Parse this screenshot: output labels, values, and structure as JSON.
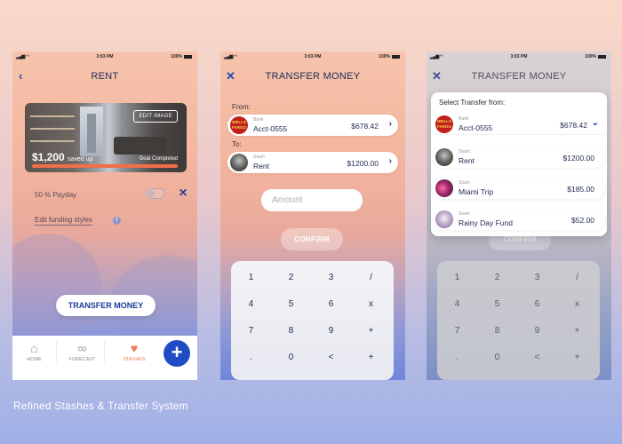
{
  "status": {
    "time": "3:03 PM",
    "battery": "100%"
  },
  "screen1": {
    "title": "RENT",
    "edit_image": "EDIT IMAGE",
    "saved_amount": "$1,200",
    "saved_label": "saved up",
    "goal": "Goal Completed",
    "payday": "50 % Payday",
    "funding_link": "Edit funding styles",
    "transfer_button": "TRANSFER MONEY",
    "tabs": [
      {
        "label": "HOME",
        "icon": "home-icon"
      },
      {
        "label": "FORECAST",
        "icon": "binoculars-icon"
      },
      {
        "label": "STASHES",
        "icon": "piggy-bank-icon"
      }
    ],
    "accent": "#ef7a5c",
    "primary": "#1f4bc4"
  },
  "screen2": {
    "title": "TRANSFER MONEY",
    "from_label": "From:",
    "to_label": "To:",
    "from": {
      "sub": "Bank",
      "name": "Acct-0555",
      "amount": "$678.42",
      "logo": "WELLS FARGO"
    },
    "to": {
      "sub": "Stash",
      "name": "Rent",
      "amount": "$1200.00"
    },
    "amount_placeholder": "Amount",
    "confirm": "CONFIRM",
    "keys": [
      "1",
      "2",
      "3",
      "/",
      "4",
      "5",
      "6",
      "x",
      "7",
      "8",
      "9",
      "+",
      ".",
      "0",
      "<",
      "+"
    ]
  },
  "screen3": {
    "title": "TRANSFER MONEY",
    "popup_title": "Select Transfer from:",
    "items": [
      {
        "sub": "Bank",
        "name": "Acct-0555",
        "amount": "$678.42",
        "logo": "WELLS FARGO"
      },
      {
        "sub": "Stash",
        "name": "Rent",
        "amount": "$1200.00"
      },
      {
        "sub": "Stash",
        "name": "Miami Trip",
        "amount": "$185.00"
      },
      {
        "sub": "Stash",
        "name": "Rainy Day Fund",
        "amount": "$52.00"
      }
    ],
    "confirm": "CONFIRM",
    "keys": [
      "1",
      "2",
      "3",
      "/",
      "4",
      "5",
      "6",
      "x",
      "7",
      "8",
      "9",
      "+",
      ".",
      "0",
      "<",
      "+"
    ]
  },
  "caption": "Refined Stashes & Transfer System"
}
